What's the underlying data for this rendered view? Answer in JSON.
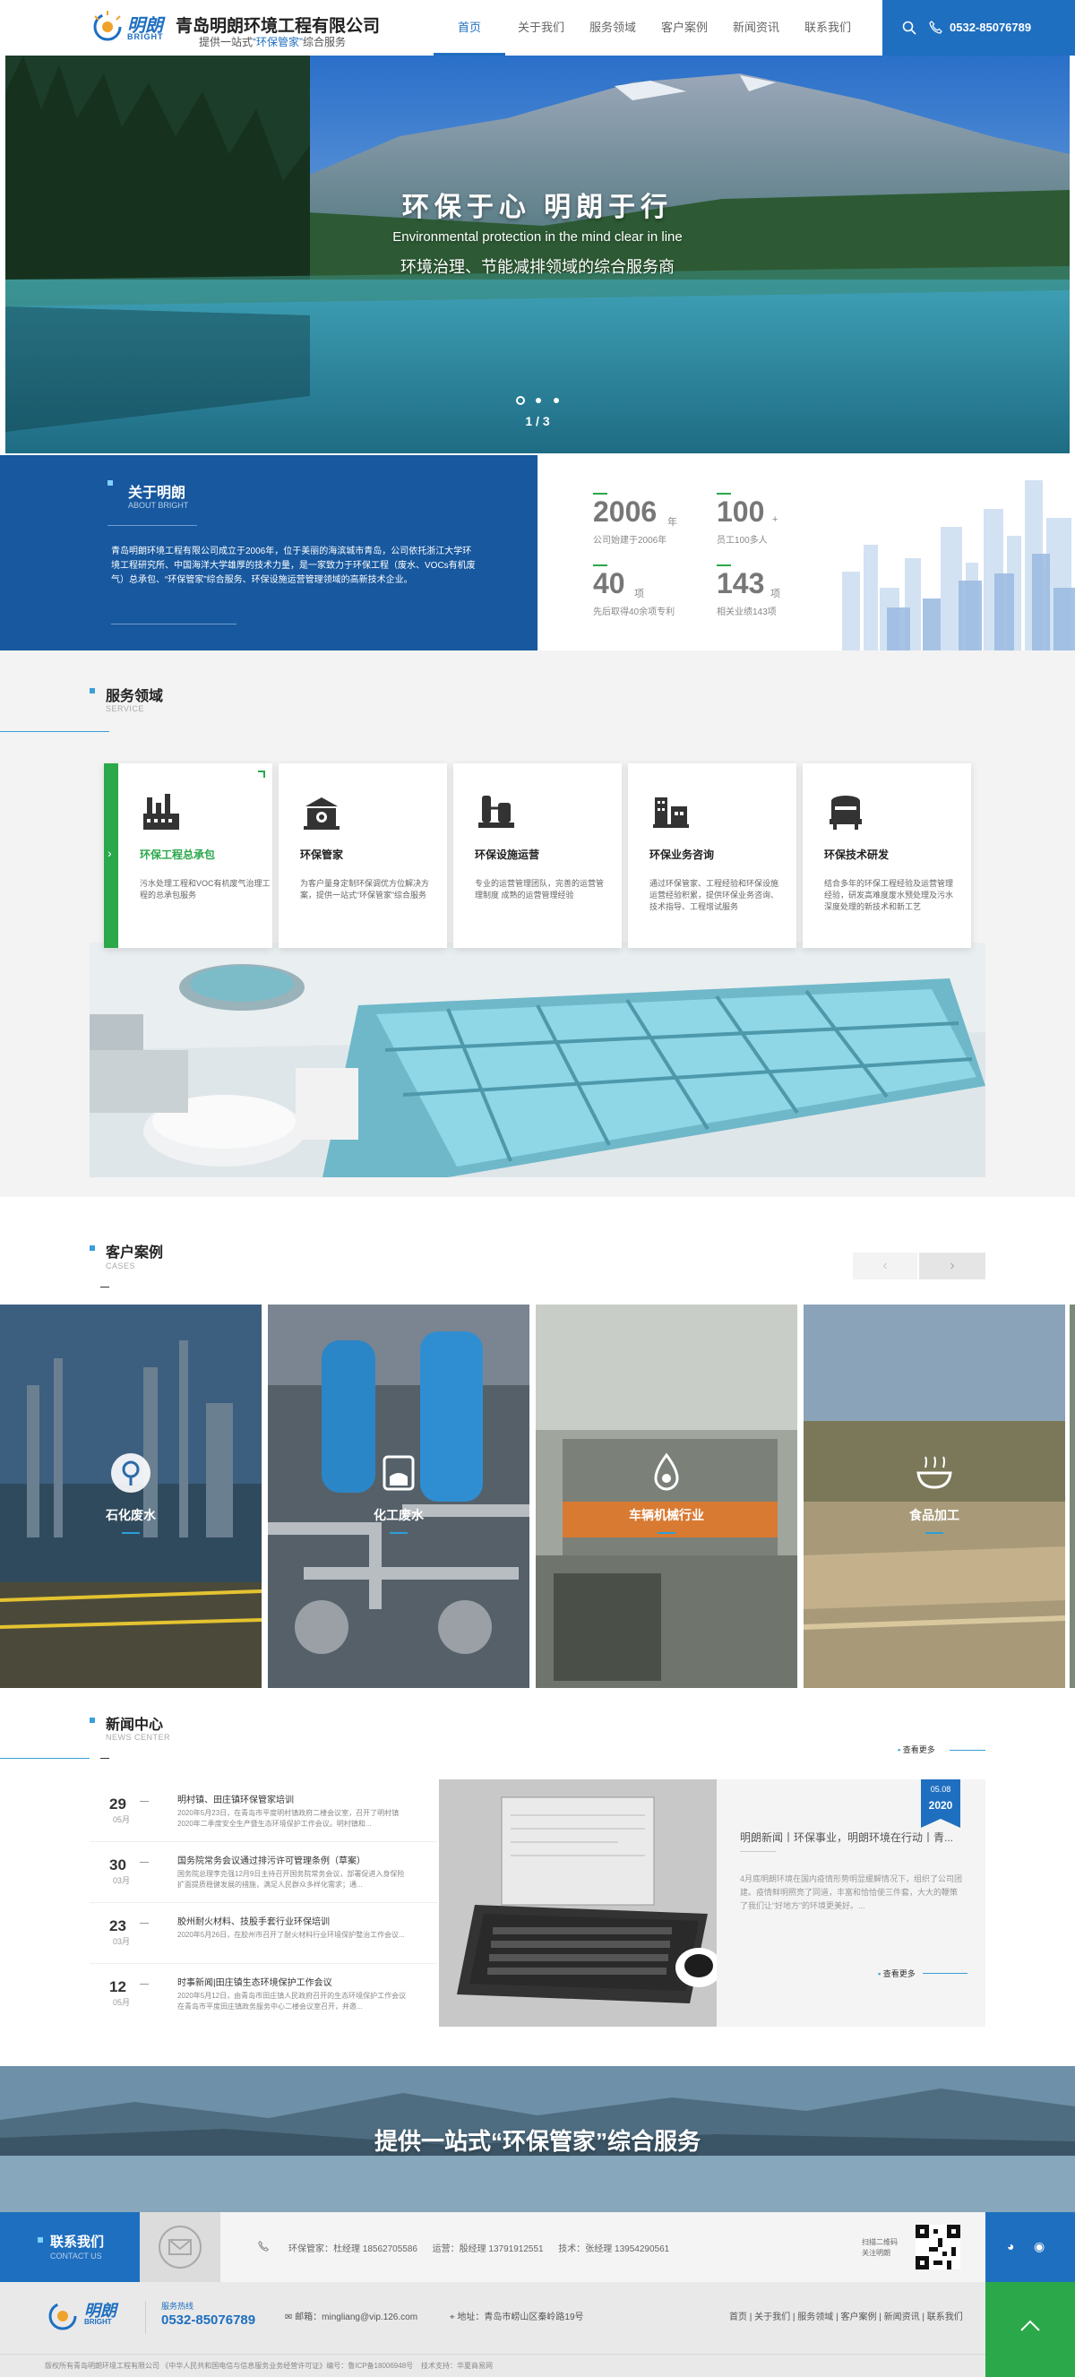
{
  "header": {
    "logo_cn": "明朗",
    "logo_en": "BRIGHT",
    "company": "青岛明朗环境工程有限公司",
    "slogan_pre": "提供一站式",
    "slogan_hl": "“环保管家”",
    "slogan_post": "综合服务",
    "nav": [
      "首页",
      "关于我们",
      "服务领域",
      "客户案例",
      "新闻资讯",
      "联系我们"
    ],
    "phone": "0532-85076789",
    "icons": {
      "search": "search-icon",
      "phone": "phone-icon"
    },
    "accent": "#1f6fc0"
  },
  "hero": {
    "title": "环保于心  明朗于行",
    "subtitle_en": "Environmental protection in the mind clear in line",
    "subtitle_cn": "环境治理、节能减排领域的综合服务商",
    "page": "1 / 3"
  },
  "about": {
    "title": "关于明朗",
    "sub": "ABOUT BRIGHT",
    "text": "青岛明朗环境工程有限公司成立于2006年，位于美丽的海滨城市青岛，公司依托浙江大学环境工程研究所、中国海洋大学雄厚的技术力量，是一家致力于环保工程（废水、VOCs有机废气）总承包、“环保管家”综合服务、环保设施运营管理领域的高新技术企业。",
    "bg": "#17589f"
  },
  "stats": [
    {
      "num": "2006",
      "unit": "年",
      "label": "公司始建于2006年"
    },
    {
      "num": "100",
      "unit": "+",
      "label": "员工100多人"
    },
    {
      "num": "40",
      "unit": "项",
      "label": "先后取得40余项专利"
    },
    {
      "num": "143",
      "unit": "项",
      "label": "相关业绩143项"
    }
  ],
  "service": {
    "title": "服务领域",
    "sub": "SERVICE",
    "cards": [
      {
        "title": "环保工程总承包",
        "desc": "污水处理工程和VOC有机废气治理工程的总承包服务"
      },
      {
        "title": "环保管家",
        "desc": "为客户量身定制环保调优方位解决方案，提供一站式“环保管家”综合服务"
      },
      {
        "title": "环保设施运营",
        "desc": "专业的运营管理团队，完善的运营管理制度 成熟的运营管理经验"
      },
      {
        "title": "环保业务咨询",
        "desc": "通过环保管家、工程经验和环保设施运营经验积累，提供环保业务咨询、技术指导、工程增试服务"
      },
      {
        "title": "环保技术研发",
        "desc": "结合多年的环保工程经验及运营管理经验，研发高难度废水预处理及污水深度处理的新技术和新工艺"
      }
    ]
  },
  "cases": {
    "title": "客户案例",
    "sub": "CASES",
    "items": [
      "石化废水",
      "化工废水",
      "车辆机械行业",
      "食品加工"
    ]
  },
  "news": {
    "title": "新闻中心",
    "sub": "NEWS CENTER",
    "more": "查看更多",
    "list": [
      {
        "day": "29",
        "month": "05月",
        "title": "明村镇、田庄镇环保管家培训",
        "summary": "2020年5月23日，在青岛市平度明村镇政府二楼会议室，召开了明村镇2020年二季度安全生产暨生态环境保护工作会议。明村镇和..."
      },
      {
        "day": "30",
        "month": "03月",
        "title": "国务院常务会议通过排污许可管理条例（草案）",
        "summary": "国务院总理李克强12月9日主持召开国务院常务会议，部署促进入身保险扩面提质稳健发展的措施，满足人民群众多样化需求；通..."
      },
      {
        "day": "23",
        "month": "03月",
        "title": "胶州耐火材料、技股手套行业环保培训",
        "summary": "2020年5月26日，在胶州市召开了耐火材料行业环境保护整治工作会议..."
      },
      {
        "day": "12",
        "month": "05月",
        "title": "时事新闻|田庄镇生态环境保护工作会议",
        "summary": "2020年5月12日，由青岛市田庄镇人民政府召开的生态环境保护工作会议在青岛市平度田庄镇政务服务中心二楼会议室召开，并邀..."
      }
    ],
    "feature": {
      "badge_date": "05.08",
      "badge_year": "2020",
      "title": "明朗新闻丨环保事业，明朗环境在行动丨青...",
      "summary": "4月底明朗环境在国内疫情形势明显缓解情况下，组织了公司团建。疫情鲜明照亮了同道，丰富和恰恰使三件套，大大的鞭策了我们让“好地方”的环境更美好。..."
    }
  },
  "banner": {
    "text": "提供一站式“环保管家”综合服务"
  },
  "contact": {
    "title": "联系我们",
    "sub": "CONTACT US",
    "line": "环保管家：杜经理 18562705586      运营：殷经理 13791912551      技术：张经理 13954290561",
    "qr_label": "扫描二维码\n关注明朗"
  },
  "footer": {
    "hotline_label": "服务热线",
    "hotline": "0532-85076789",
    "email_label": "邮箱：",
    "email": "mingliang@vip.126.com",
    "address_label": "地址：",
    "address": "青岛市崂山区秦岭路19号",
    "links": "首页 | 关于我们 | 服务领域 | 客户案例 | 新闻资讯 | 联系我们",
    "copyright": "版权所有青岛明朗环境工程有限公司 《中华人民共和国电信与信息服务业务经营许可证》编号：鲁ICP备18006948号    技术支持：华夏商易网"
  }
}
